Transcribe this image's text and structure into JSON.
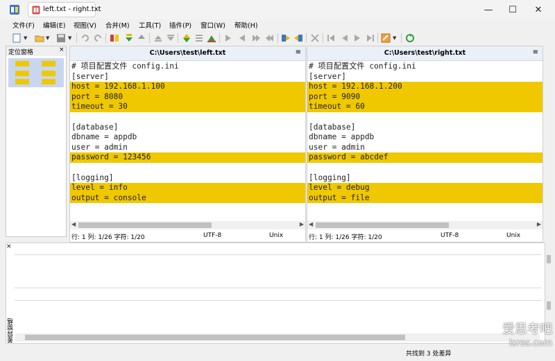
{
  "window": {
    "tab_title": "left.txt - right.txt",
    "minimize_glyph": "—",
    "maximize_glyph": "☐",
    "close_glyph": "✕"
  },
  "menu": [
    "文件(F)",
    "编辑(E)",
    "视图(V)",
    "合并(M)",
    "工具(T)",
    "插件(P)",
    "窗口(W)",
    "帮助(H)"
  ],
  "locator": {
    "title": "定位窗格",
    "close": "×"
  },
  "left_panel": {
    "path": "C:\\Users\\test\\left.txt",
    "menu_glyph": "≡",
    "lines": [
      {
        "text": "# 项目配置文件 config.ini",
        "state": "same"
      },
      {
        "text": "[server]",
        "state": "same"
      },
      {
        "text": "host = 192.168.1.100",
        "state": "diff"
      },
      {
        "text": "port = 8080",
        "state": "diff"
      },
      {
        "text": "timeout = 30",
        "state": "diff"
      },
      {
        "text": "",
        "state": "same"
      },
      {
        "text": "[database]",
        "state": "same"
      },
      {
        "text": "dbname = appdb",
        "state": "same"
      },
      {
        "text": "user = admin",
        "state": "same"
      },
      {
        "text": "password = 123456",
        "state": "diff"
      },
      {
        "text": "",
        "state": "same"
      },
      {
        "text": "[logging]",
        "state": "same"
      },
      {
        "text": "level = info",
        "state": "diff"
      },
      {
        "text": "output = console",
        "state": "diff"
      }
    ],
    "status": {
      "position": "行: 1  列: 1/26  字符: 1/20",
      "encoding": "UTF-8",
      "eol": "Unix"
    }
  },
  "right_panel": {
    "path": "C:\\Users\\test\\right.txt",
    "menu_glyph": "≡",
    "lines": [
      {
        "text": "# 项目配置文件 config.ini",
        "state": "same"
      },
      {
        "text": "[server]",
        "state": "same"
      },
      {
        "text": "host = 192.168.1.200",
        "state": "diff"
      },
      {
        "text": "port = 9090",
        "state": "diff"
      },
      {
        "text": "timeout = 60",
        "state": "diff"
      },
      {
        "text": "",
        "state": "same"
      },
      {
        "text": "[database]",
        "state": "same"
      },
      {
        "text": "dbname = appdb",
        "state": "same"
      },
      {
        "text": "user = admin",
        "state": "same"
      },
      {
        "text": "password = abcdef",
        "state": "diff"
      },
      {
        "text": "",
        "state": "same"
      },
      {
        "text": "[logging]",
        "state": "same"
      },
      {
        "text": "level = debug",
        "state": "diff"
      },
      {
        "text": "output = file",
        "state": "diff"
      }
    ],
    "status": {
      "position": "行: 1  列: 1/26  字符: 1/20",
      "encoding": "UTF-8",
      "eol": "Unix"
    }
  },
  "diff_pane": {
    "label": "差异窗格",
    "close": "×"
  },
  "statusbar": {
    "found": "共找到 3 处差异"
  },
  "watermark": {
    "line1": "爱思考吧",
    "line2": "isres.com"
  },
  "colors": {
    "diff": "#f0c800",
    "header": "#eaf0f8"
  }
}
